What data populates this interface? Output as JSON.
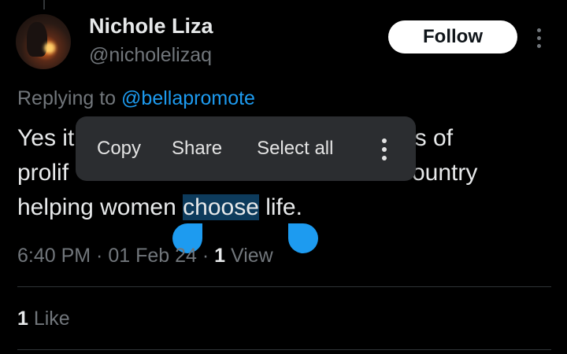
{
  "tweet": {
    "author_name": "Nichole Liza",
    "author_handle": "@nicholelizaq",
    "follow_label": "Follow",
    "replying_prefix": "Replying to ",
    "replying_mention": "@bellapromote",
    "body": {
      "line1_start": "Yes it",
      "line1_end": "ds of",
      "line2_start": "prolif",
      "line2_end": "country",
      "line3_before": "helping women ",
      "line3_selected": "choose",
      "line3_after": " life."
    },
    "meta": {
      "time": "6:40 PM",
      "sep1": " · ",
      "date": "01 Feb 24",
      "sep2": " · ",
      "view_count": "1",
      "view_label": " View"
    },
    "likes": {
      "count": "1",
      "label": " Like"
    }
  },
  "context_menu": {
    "copy_label": "Copy",
    "share_label": "Share",
    "select_all_label": "Select all",
    "more_icon": "more-vertical-icon"
  },
  "colors": {
    "background": "#000000",
    "text": "#e7e9ea",
    "secondary": "#71767b",
    "accent": "#1d9bf0",
    "menu_bg": "#2b2d30",
    "selection": "#0d3b5c"
  }
}
